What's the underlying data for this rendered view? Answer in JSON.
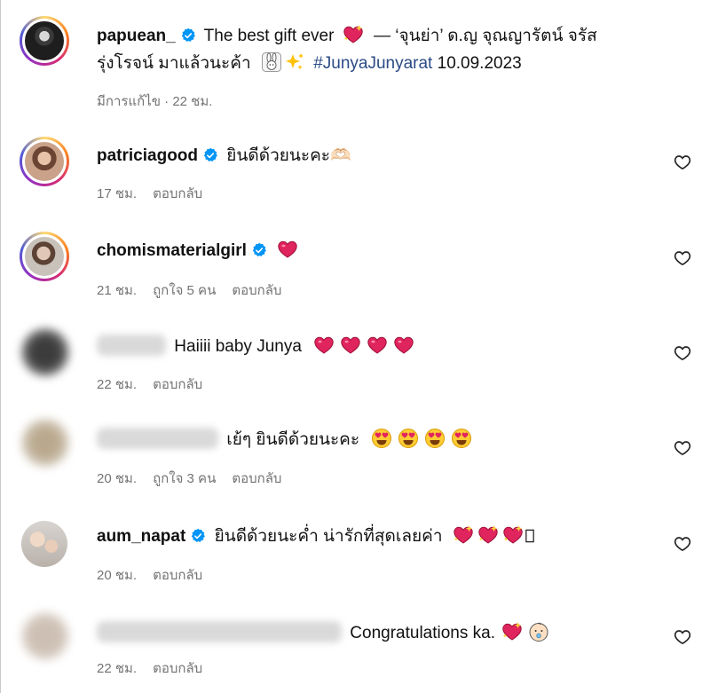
{
  "post": {
    "username": "papuean_",
    "caption_part1": "The best gift ever",
    "caption_part2": "— ‘จุนย่า’ ด.ญ จุณญารัตน์ จรัส",
    "caption_line2": "รุ่งโรจน์ มาแล้วนะค้า",
    "hashtag": "#JunyaJunyarat",
    "date": "10.09.2023",
    "meta": "มีการแก้ไข · 22 ชม."
  },
  "comments": [
    {
      "username": "patriciagood",
      "text": "ยินดีด้วยนะคะ🫶🏻",
      "time": "17 ชม.",
      "likes": "",
      "reply": "ตอบกลับ"
    },
    {
      "username": "chomismaterialgirl",
      "text": "",
      "time": "21 ชม.",
      "likes": "ถูกใจ 5 คน",
      "reply": "ตอบกลับ"
    },
    {
      "username": "",
      "text": "Haiiii baby Junya",
      "time": "22 ชม.",
      "likes": "",
      "reply": "ตอบกลับ"
    },
    {
      "username": "",
      "text": "เย้ๆ ยินดีด้วยนะคะ",
      "time": "20 ชม.",
      "likes": "ถูกใจ 3 คน",
      "reply": "ตอบกลับ"
    },
    {
      "username": "aum_napat",
      "text": "ยินดีด้วยนะค่ำ น่ารักที่สุดเลยค่า",
      "time": "20 ชม.",
      "likes": "",
      "reply": "ตอบกลับ"
    },
    {
      "username": "",
      "text": "Congratulations ka.",
      "time": "22 ชม.",
      "likes": "",
      "reply": "ตอบกลับ"
    }
  ],
  "icons": {
    "verified": "verified-badge-icon",
    "like": "heart-outline-icon"
  },
  "colors": {
    "verified": "#0095f6",
    "heart": "#e0245e",
    "meta": "#737373",
    "hashtag": "#2b4b85"
  }
}
